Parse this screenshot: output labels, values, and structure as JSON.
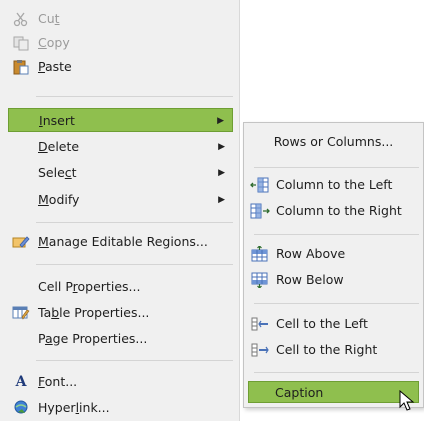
{
  "main_menu": {
    "items": [
      {
        "pre": "Cu",
        "u": "t",
        "post": "",
        "icon": "scissors-icon",
        "disabled": true
      },
      {
        "pre": "",
        "u": "C",
        "post": "opy",
        "icon": "copy-icon",
        "disabled": true
      },
      {
        "pre": "",
        "u": "P",
        "post": "aste",
        "icon": "paste-icon",
        "disabled": false
      },
      {
        "pre": "",
        "u": "I",
        "post": "nsert",
        "icon": "",
        "disabled": false,
        "submenu": true
      },
      {
        "pre": "",
        "u": "D",
        "post": "elete",
        "icon": "",
        "disabled": false,
        "submenu": true
      },
      {
        "pre": "Sele",
        "u": "c",
        "post": "t",
        "icon": "",
        "disabled": false,
        "submenu": true
      },
      {
        "pre": "",
        "u": "M",
        "post": "odify",
        "icon": "",
        "disabled": false,
        "submenu": true
      },
      {
        "pre": "",
        "u": "M",
        "post": "anage Editable Regions...",
        "icon": "editable-regions-icon",
        "disabled": false
      },
      {
        "pre": "Cell P",
        "u": "r",
        "post": "operties...",
        "icon": "",
        "disabled": false
      },
      {
        "pre": "Ta",
        "u": "b",
        "post": "le Properties...",
        "icon": "table-properties-icon",
        "disabled": false
      },
      {
        "pre": "P",
        "u": "a",
        "post": "ge Properties...",
        "icon": "",
        "disabled": false
      },
      {
        "pre": "",
        "u": "F",
        "post": "ont...",
        "icon": "font-icon",
        "disabled": false
      },
      {
        "pre": "Hyper",
        "u": "l",
        "post": "ink...",
        "icon": "hyperlink-icon",
        "disabled": false
      }
    ]
  },
  "insert_submenu": {
    "items": [
      {
        "label": "Rows or Columns...",
        "icon": ""
      },
      {
        "label": "Column to the Left",
        "icon": "column-left-icon"
      },
      {
        "label": "Column to the Right",
        "icon": "column-right-icon"
      },
      {
        "label": "Row Above",
        "icon": "row-above-icon"
      },
      {
        "label": "Row Below",
        "icon": "row-below-icon"
      },
      {
        "label": "Cell to the Left",
        "icon": "cell-left-icon"
      },
      {
        "label": "Cell to the Right",
        "icon": "cell-right-icon"
      },
      {
        "label": "Caption",
        "icon": ""
      }
    ]
  },
  "colors": {
    "highlight": "#8fbf4e",
    "highlight_border": "#6e9e33",
    "menu_bg": "#f0f0f0"
  }
}
